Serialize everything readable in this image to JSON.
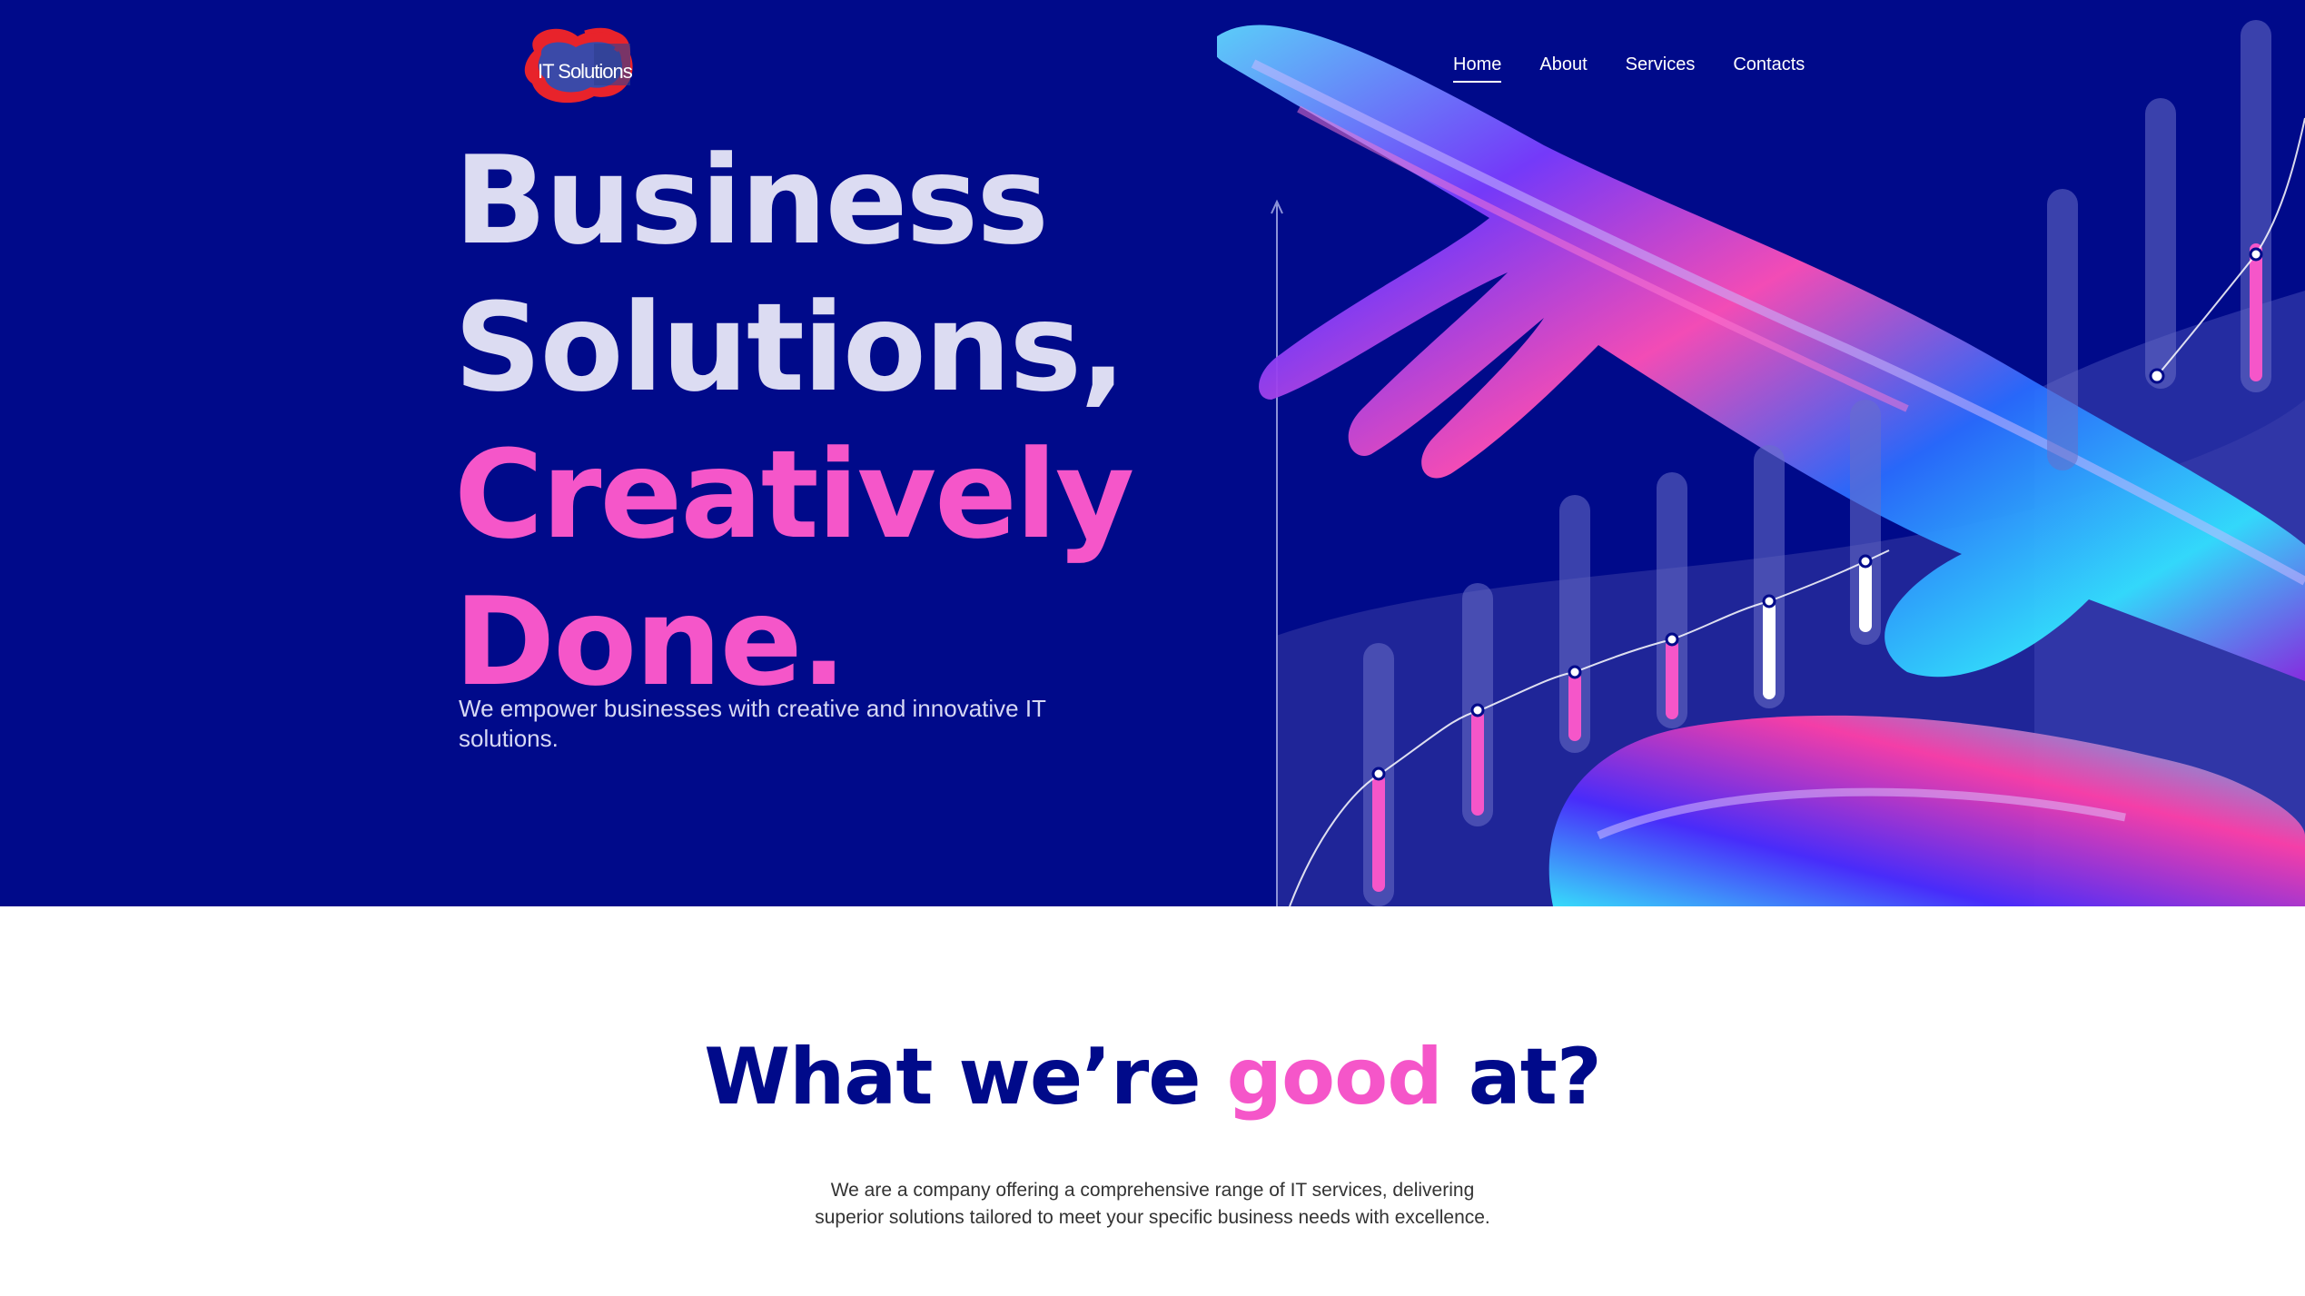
{
  "header": {
    "logo_text": "IT Solutions",
    "nav": [
      {
        "label": "Home",
        "active": true
      },
      {
        "label": "About",
        "active": false
      },
      {
        "label": "Services",
        "active": false
      },
      {
        "label": "Contacts",
        "active": false
      }
    ]
  },
  "hero": {
    "line1": "Business",
    "line2": "Solutions,",
    "line3": "Creatively",
    "line4": "Done.",
    "subtitle": "We empower businesses with creative and innovative IT solutions.",
    "illustration_icon": "holographic-hand-bar-chart-illustration"
  },
  "section": {
    "title_part1": "What we’re ",
    "title_highlight": "good",
    "title_part2": " at?",
    "text": "We are a company offering a comprehensive range of IT services, delivering superior solutions tailored to meet your specific business needs with excellence."
  },
  "colors": {
    "hero_background": "#000a8a",
    "accent_pink": "#f556c9",
    "headline_light": "#dcdcf2",
    "title_navy": "#000a8a"
  }
}
